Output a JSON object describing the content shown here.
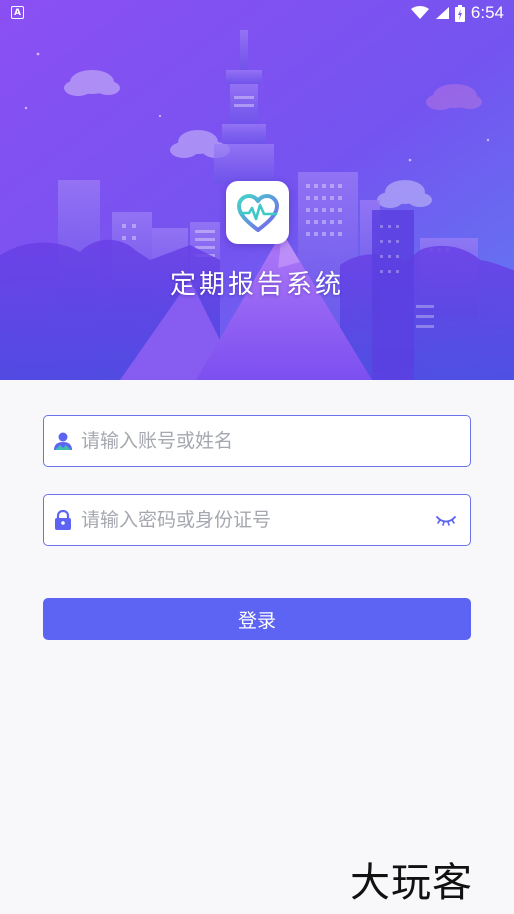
{
  "status_bar": {
    "time": "6:54",
    "left_icon": "A"
  },
  "header": {
    "app_title": "定期报告系统",
    "logo_icon": "heart-pulse-icon"
  },
  "login_form": {
    "account_placeholder": "请输入账号或姓名",
    "password_placeholder": "请输入密码或身份证号",
    "submit_label": "登录"
  },
  "watermark": {
    "text": "大玩客"
  },
  "colors": {
    "accent": "#5d64f4",
    "field_border": "#6b72ea",
    "hero_top": "#7b4ff0",
    "hero_bottom": "#5a67f0",
    "background": "#f8f8fa"
  }
}
